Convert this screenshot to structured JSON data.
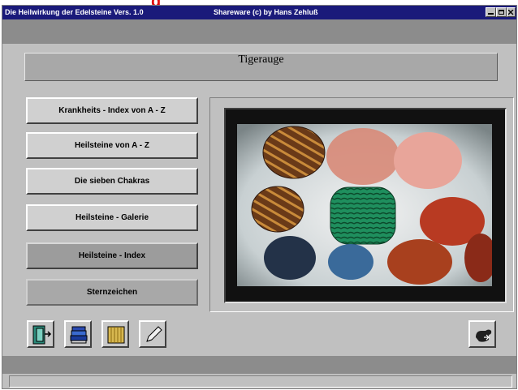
{
  "window": {
    "title_left": "Die Heilwirkung der Edelsteine  Vers. 1.0",
    "title_right": "Shareware  (c) by Hans Zehluß",
    "banner_fragment": "g"
  },
  "header": {
    "title": "Tigerauge"
  },
  "menu": [
    {
      "label": "Krankheits - Index von A - Z"
    },
    {
      "label": "Heilsteine von A - Z"
    },
    {
      "label": "Die sieben Chakras"
    },
    {
      "label": "Heilsteine - Galerie"
    },
    {
      "label": "Heilsteine - Index"
    },
    {
      "label": "Sternzeichen"
    }
  ],
  "toolbar": [
    {
      "icon": "exit-door-icon"
    },
    {
      "icon": "books-icon"
    },
    {
      "icon": "scroll-icon"
    },
    {
      "icon": "pencil-icon"
    }
  ],
  "help_icon": "hand-pointer-icon",
  "colors": {
    "titlebar": "#1a1a7a",
    "panel": "#c0c0c0",
    "header": "#a8a8a8"
  }
}
